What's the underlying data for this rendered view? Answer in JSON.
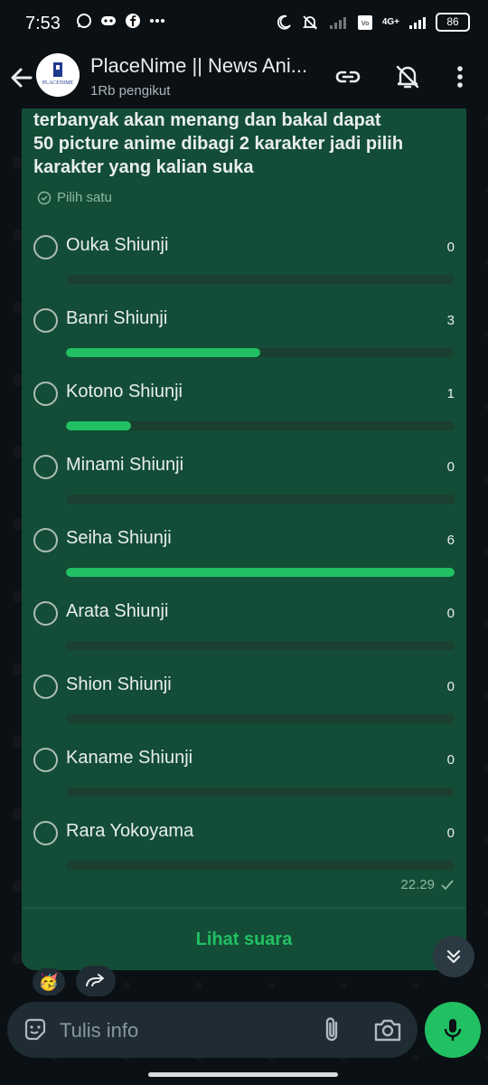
{
  "status_bar": {
    "time": "7:53",
    "battery": "86",
    "network": "4G+"
  },
  "header": {
    "title": "PlaceNime || News Ani...",
    "subtitle": "1Rb pengikut",
    "avatar_text": "PLACENIME"
  },
  "poll": {
    "question_lines": [
      "terbanyak akan menang dan bakal dapat",
      "50 picture anime dibagi 2 karakter jadi pilih",
      "karakter yang kalian suka"
    ],
    "pick_label": "Pilih satu",
    "max_votes": 6,
    "options": [
      {
        "label": "Ouka Shiunji",
        "count": "0",
        "fraction": 0
      },
      {
        "label": "Banri Shiunji",
        "count": "3",
        "fraction": 0.5
      },
      {
        "label": "Kotono Shiunji",
        "count": "1",
        "fraction": 0.1667
      },
      {
        "label": "Minami Shiunji",
        "count": "0",
        "fraction": 0
      },
      {
        "label": "Seiha Shiunji",
        "count": "6",
        "fraction": 1
      },
      {
        "label": "Arata Shiunji",
        "count": "0",
        "fraction": 0
      },
      {
        "label": "Shion Shiunji",
        "count": "0",
        "fraction": 0
      },
      {
        "label": "Kaname Shiunji",
        "count": "0",
        "fraction": 0
      },
      {
        "label": "Rara Yokoyama",
        "count": "0",
        "fraction": 0
      }
    ],
    "timestamp": "22.29",
    "view_votes_label": "Lihat suara"
  },
  "reaction": {
    "emoji": "🥳"
  },
  "input": {
    "placeholder": "Tulis info"
  },
  "icons": {
    "back": "arrow-left-icon",
    "link": "link-icon",
    "mute": "bell-off-icon",
    "menu": "more-vertical-icon",
    "emoji": "sticker-icon",
    "attach": "paperclip-icon",
    "camera": "camera-icon",
    "mic": "microphone-icon",
    "scroll": "double-chevron-down-icon",
    "forward": "forward-icon"
  },
  "colors": {
    "accent": "#21c063",
    "card": "#134d37",
    "background": "#0b1014"
  }
}
